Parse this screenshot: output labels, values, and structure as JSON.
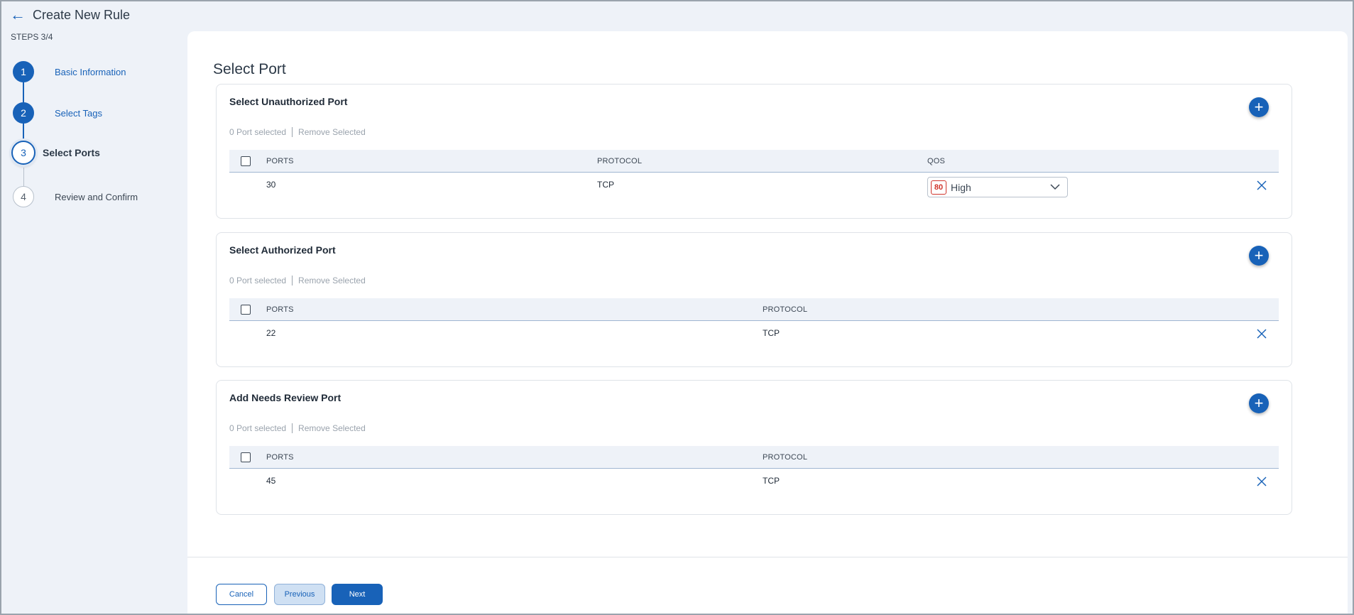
{
  "header": {
    "back_icon": "arrow-left-icon",
    "title": "Create New Rule",
    "steps_label": "STEPS 3/4"
  },
  "stepper": {
    "steps": [
      {
        "number": "1",
        "label": "Basic Information",
        "state": "done"
      },
      {
        "number": "2",
        "label": "Select Tags",
        "state": "done"
      },
      {
        "number": "3",
        "label": "Select Ports",
        "state": "active"
      },
      {
        "number": "4",
        "label": "Review and Confirm",
        "state": "todo"
      }
    ]
  },
  "main": {
    "section_title": "Select Port",
    "panels": [
      {
        "title": "Select Unauthorized Port",
        "selected_text": "0 Port selected",
        "remove_label": "Remove Selected",
        "columns": [
          "PORTS",
          "PROTOCOL",
          "QOS"
        ],
        "rows": [
          {
            "port": "30",
            "protocol": "TCP",
            "qos_score": "80",
            "qos_level": "High"
          }
        ]
      },
      {
        "title": "Select Authorized Port",
        "selected_text": "0 Port selected",
        "remove_label": "Remove Selected",
        "columns": [
          "PORTS",
          "PROTOCOL"
        ],
        "rows": [
          {
            "port": "22",
            "protocol": "TCP"
          }
        ]
      },
      {
        "title": "Add Needs Review Port",
        "selected_text": "0 Port selected",
        "remove_label": "Remove Selected",
        "columns": [
          "PORTS",
          "PROTOCOL"
        ],
        "rows": [
          {
            "port": "45",
            "protocol": "TCP"
          }
        ]
      }
    ]
  },
  "footer": {
    "cancel_label": "Cancel",
    "previous_label": "Previous",
    "next_label": "Next"
  },
  "colors": {
    "primary": "#1862b8",
    "qos_high": "#d0352c",
    "background": "#eef2f8"
  }
}
